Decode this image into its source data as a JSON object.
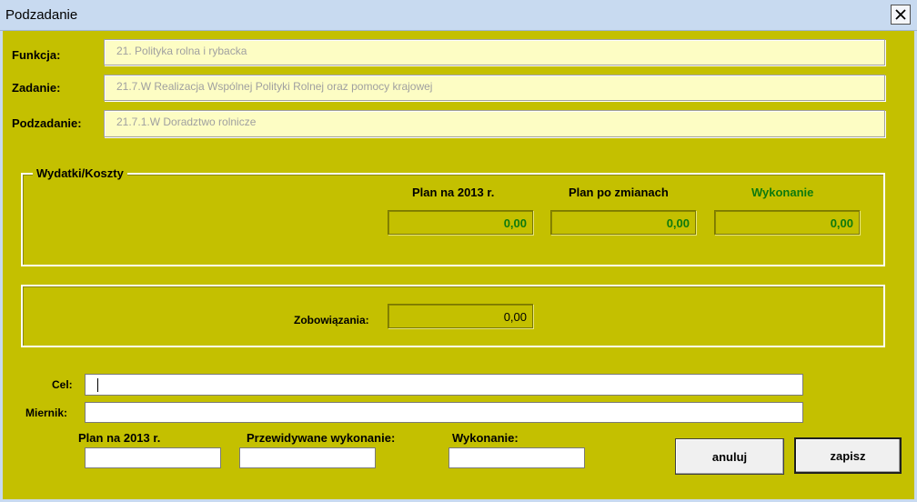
{
  "window": {
    "title": "Podzadanie",
    "close_icon": "close-icon"
  },
  "fields": {
    "funkcja": {
      "label": "Funkcja:",
      "value": "21. Polityka rolna i rybacka"
    },
    "zadanie": {
      "label": "Zadanie:",
      "value": "21.7.W Realizacja Wspólnej Polityki Rolnej oraz pomocy krajowej"
    },
    "podzadanie": {
      "label": "Podzadanie:",
      "value": "21.7.1.W Doradztwo rolnicze"
    }
  },
  "wydatki": {
    "legend": "Wydatki/Koszty",
    "headers": {
      "plan": "Plan na 2013 r.",
      "plan_po_zmianach": "Plan po zmianach",
      "wykonanie": "Wykonanie"
    },
    "values": {
      "plan": "0,00",
      "plan_po_zmianach": "0,00",
      "wykonanie": "0,00"
    }
  },
  "zobowiazania": {
    "label": "Zobowiązania:",
    "value": "0,00"
  },
  "form": {
    "cel_label": "Cel:",
    "cel_value": "",
    "miernik_label": "Miernik:",
    "miernik_value": "",
    "plan_label": "Plan na 2013 r.",
    "przewidywane_label": "Przewidywane wykonanie:",
    "wykonanie_label": "Wykonanie:"
  },
  "buttons": {
    "anuluj": "anuluj",
    "zapisz": "zapisz"
  },
  "colors": {
    "background": "#c4c000",
    "field_bg": "#fdfdc4",
    "accent_green": "#0e7a0e",
    "titlebar": "#c8daf0"
  }
}
